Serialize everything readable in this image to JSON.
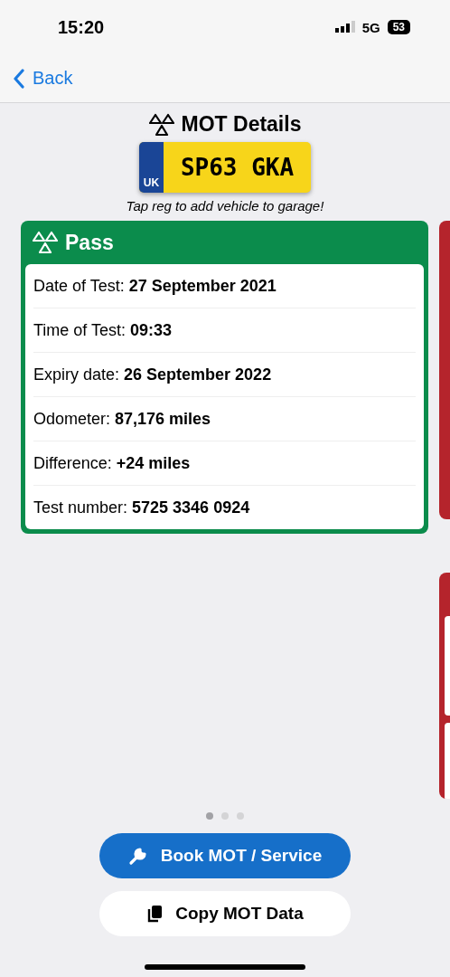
{
  "status_bar": {
    "time": "15:20",
    "network": "5G",
    "battery": "53"
  },
  "nav": {
    "back": "Back"
  },
  "header": {
    "title": "MOT Details",
    "plate_country": "UK",
    "plate": "SP63 GKA",
    "hint": "Tap reg to add vehicle to garage!"
  },
  "result": {
    "kind": "pass",
    "title": "Pass",
    "fields": [
      {
        "label": "Date of Test:",
        "value": "27 September 2021"
      },
      {
        "label": "Time of Test:",
        "value": "09:33"
      },
      {
        "label": "Expiry date:",
        "value": "26 September 2022"
      },
      {
        "label": "Odometer:",
        "value": "87,176 miles"
      },
      {
        "label": "Difference:",
        "value": "+24 miles"
      },
      {
        "label": "Test number:",
        "value": "5725 3346 0924"
      }
    ]
  },
  "page_dots": [
    {
      "selected": true
    },
    {
      "selected": false
    },
    {
      "selected": false
    }
  ],
  "buttons": [
    {
      "kind": "book",
      "label": "Book MOT / Service"
    },
    {
      "kind": "copy",
      "label": "Copy MOT Data"
    }
  ]
}
